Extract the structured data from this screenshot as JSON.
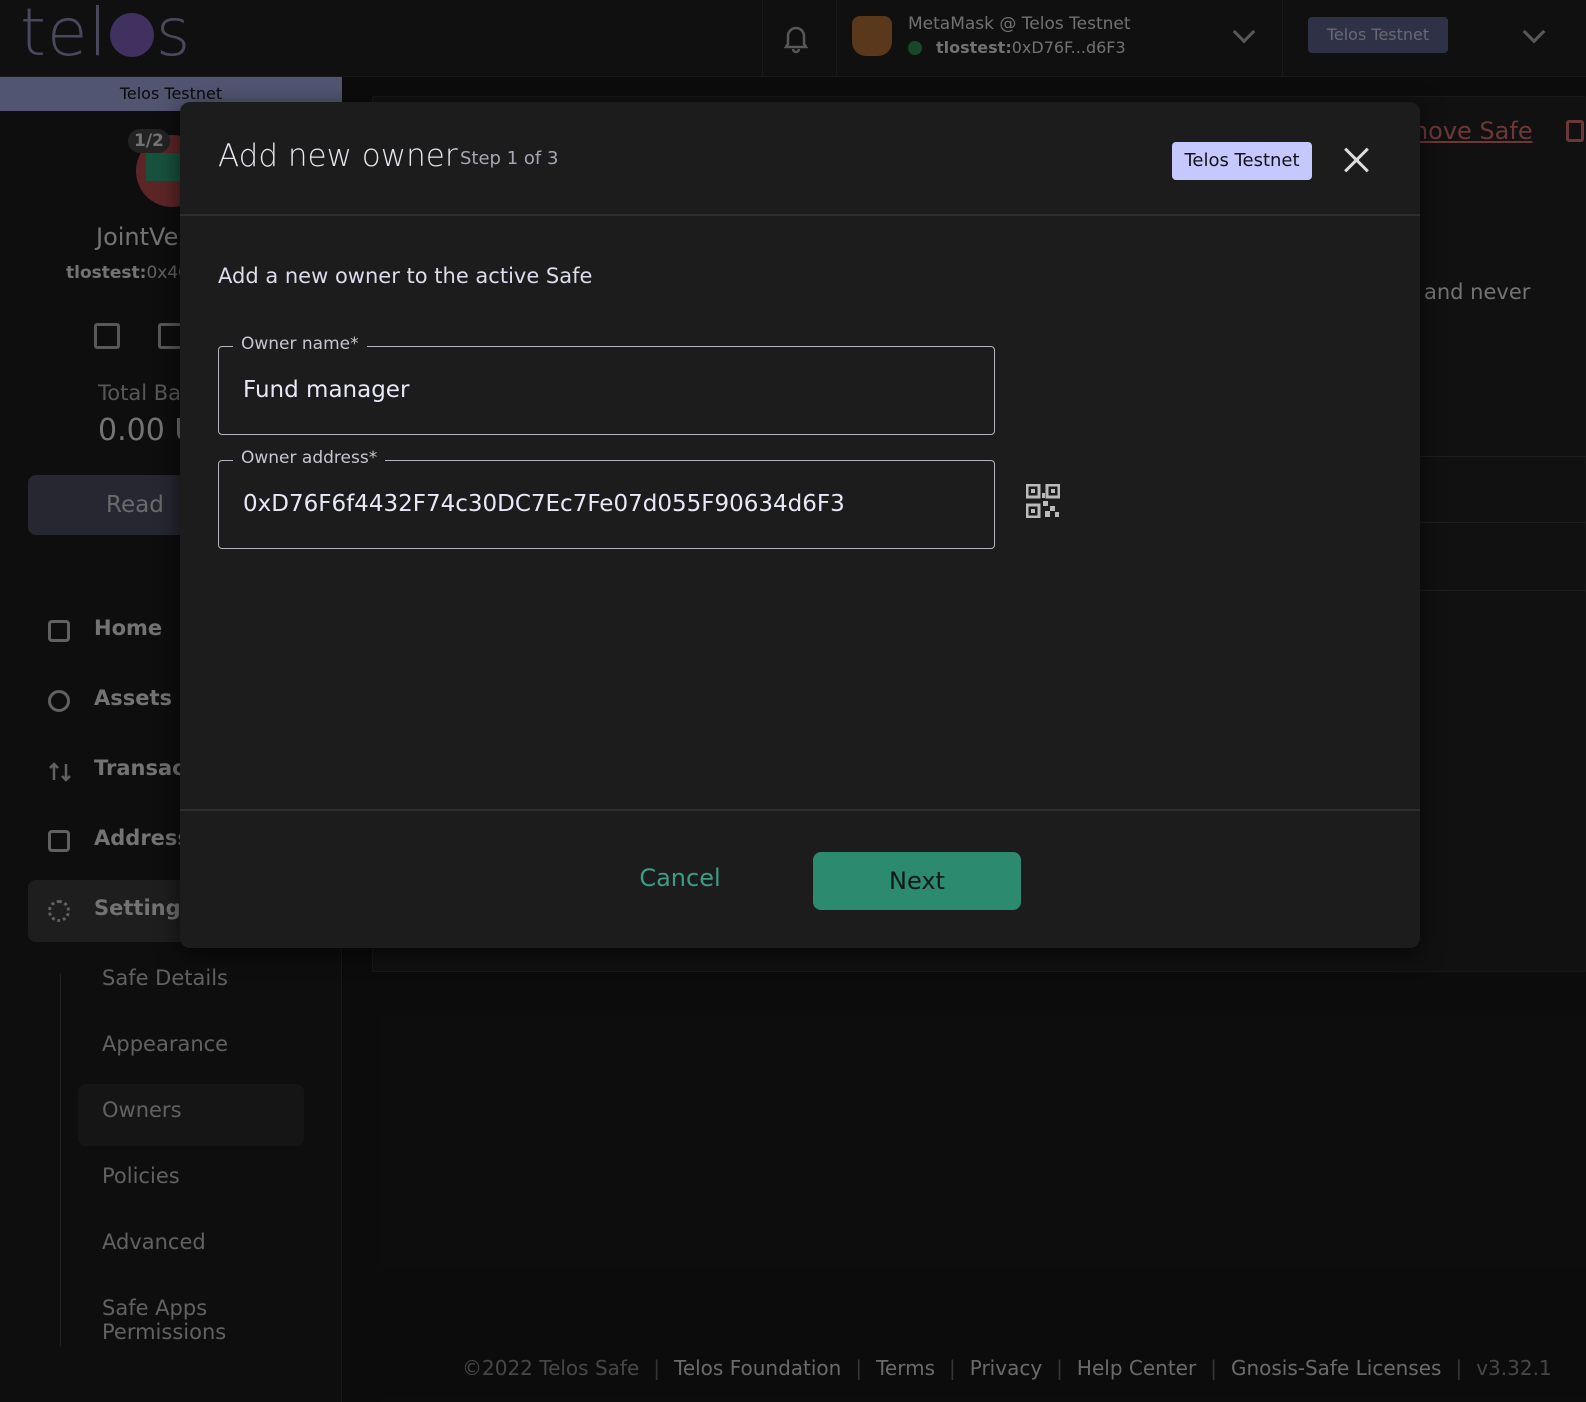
{
  "topbar": {
    "logo_text": "tel",
    "logo_text_end": "s",
    "wallet_title": "MetaMask @ Telos Testnet",
    "wallet_addr_prefix": "tlostest:",
    "wallet_addr": "0xD76F...d6F3",
    "network_label": "Telos Testnet"
  },
  "sidebar": {
    "network_banner": "Telos Testnet",
    "threshold": "1/2",
    "safe_name": "JointVe",
    "safe_addr_prefix": "tlostest:",
    "safe_addr": "0x4C",
    "total_label": "Total Ba",
    "total_value": "0.00 U",
    "read_button": "Read",
    "nav": [
      {
        "label": "Home",
        "icon": "home-icon"
      },
      {
        "label": "Assets",
        "icon": "assets-icon"
      },
      {
        "label": "Transac",
        "icon": "transactions-icon"
      },
      {
        "label": "Address",
        "icon": "address-book-icon"
      },
      {
        "label": "Settings",
        "icon": "gear-icon"
      }
    ],
    "settings_sub": [
      "Safe Details",
      "Appearance",
      "Owners",
      "Policies",
      "Advanced",
      "Safe Apps\nPermissions"
    ]
  },
  "main": {
    "remove_safe": "emove Safe",
    "partial_text": "and never"
  },
  "footer": {
    "copyright": "©2022 Telos Safe",
    "links": [
      "Telos Foundation",
      "Terms",
      "Privacy",
      "Help Center",
      "Gnosis-Safe Licenses"
    ],
    "version": "v3.32.1"
  },
  "modal": {
    "title": "Add new owner",
    "step": "Step 1 of 3",
    "network_chip": "Telos Testnet",
    "description": "Add a new owner to the active Safe",
    "owner_name_label": "Owner name*",
    "owner_name_value": "Fund manager",
    "owner_address_label": "Owner address*",
    "owner_address_value": "0xD76F6f4432F74c30DC7Ec7Fe07d055F90634d6F3",
    "cancel_label": "Cancel",
    "next_label": "Next"
  },
  "colors": {
    "accent": "#2c8a6e",
    "chip": "#c5c8ff",
    "danger": "#d46a6a"
  }
}
